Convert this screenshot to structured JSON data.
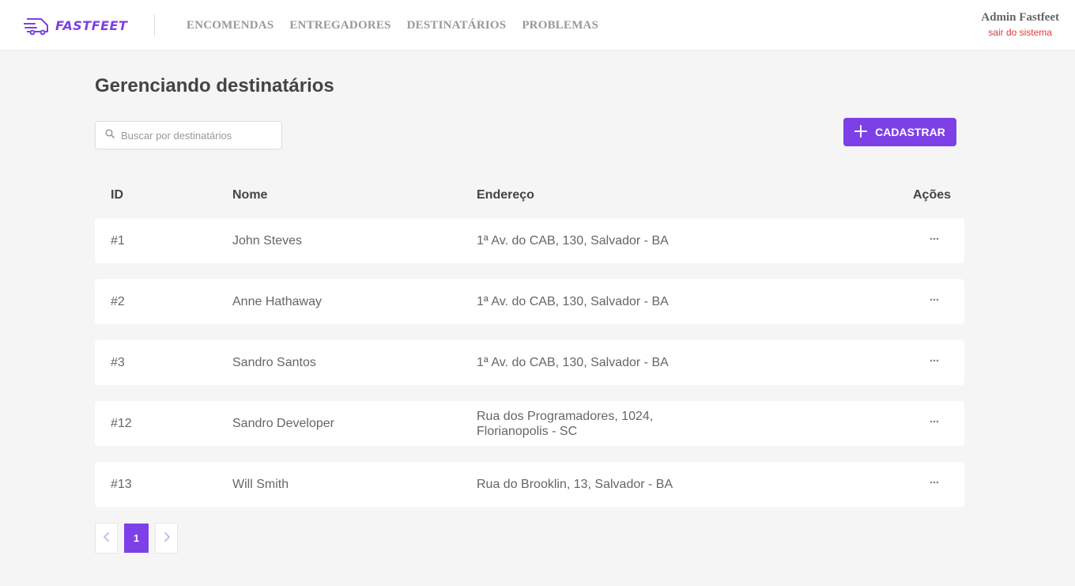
{
  "header": {
    "brand": "FASTFEET",
    "nav": [
      "ENCOMENDAS",
      "ENTREGADORES",
      "DESTINATÁRIOS",
      "PROBLEMAS"
    ],
    "user_name": "Admin Fastfeet",
    "logout_label": "sair do sistema"
  },
  "page": {
    "title": "Gerenciando destinatários"
  },
  "search": {
    "placeholder": "Buscar por destinatários",
    "value": ""
  },
  "add_button": {
    "label": "CADASTRAR"
  },
  "table": {
    "headers": {
      "id": "ID",
      "name": "Nome",
      "address": "Endereço",
      "actions": "Ações"
    },
    "rows": [
      {
        "id": "#1",
        "name": "John Steves",
        "address": [
          "1ª Av. do CAB, 130, Salvador - BA"
        ]
      },
      {
        "id": "#2",
        "name": "Anne Hathaway",
        "address": [
          "1ª Av. do CAB, 130, Salvador - BA"
        ]
      },
      {
        "id": "#3",
        "name": "Sandro Santos",
        "address": [
          "1ª Av. do CAB, 130, Salvador - BA"
        ]
      },
      {
        "id": "#12",
        "name": "Sandro Developer",
        "address": [
          "Rua dos Programadores, 1024,",
          "Florianopolis - SC"
        ]
      },
      {
        "id": "#13",
        "name": "Will Smith",
        "address": [
          "Rua do Brooklin, 13, Salvador - BA"
        ]
      }
    ]
  },
  "pagination": {
    "current_page": "1"
  },
  "colors": {
    "accent": "#7d40e7",
    "logout": "#de3b3b",
    "background": "#f5f5f5"
  },
  "icons": {
    "brand": "delivery-truck-icon",
    "search": "search-icon",
    "add": "plus-icon",
    "row_actions": "more-horizontal-icon",
    "prev": "chevron-left-icon",
    "next": "chevron-right-icon"
  }
}
